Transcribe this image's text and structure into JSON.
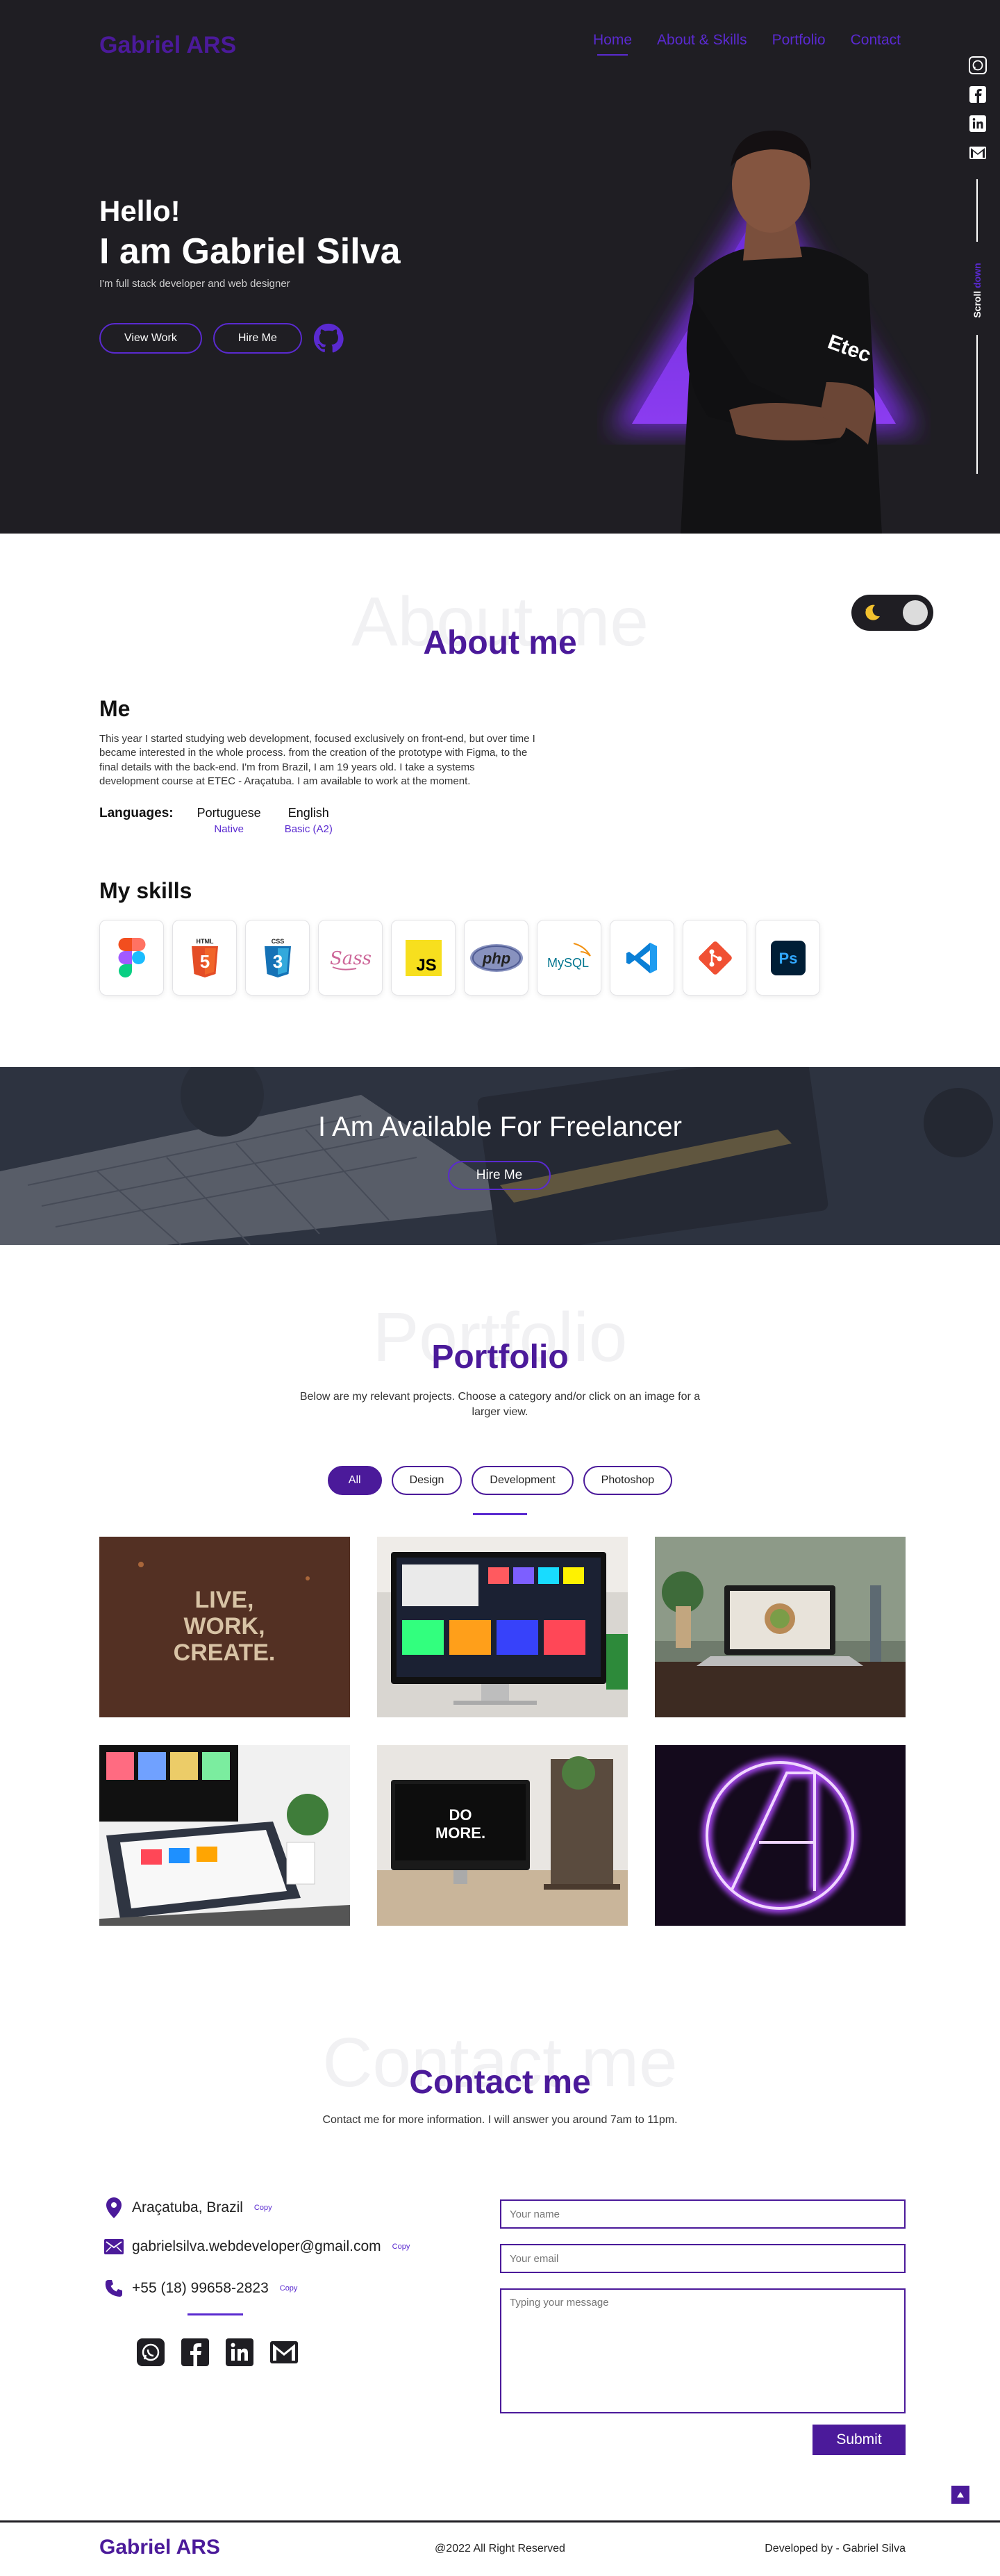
{
  "brand": {
    "logo": "Gabriel ARS"
  },
  "nav": {
    "home": "Home",
    "about": "About & Skills",
    "portfolio": "Portfolio",
    "contact": "Contact"
  },
  "hero": {
    "hello": "Hello!",
    "name": "I am Gabriel Silva",
    "subtitle": "I'm full stack developer and web designer",
    "view_work": "View Work",
    "hire_me": "Hire Me",
    "scroll_word": "Scroll",
    "scroll_dim": "down",
    "shirt_text": "Etec"
  },
  "about": {
    "bg_title": "About me",
    "title": "About me",
    "me_title": "Me",
    "me_text": "This year I started studying web development, focused exclusively on front-end, but over time I became interested in the whole process. from the creation of the prototype with Figma, to the final details with the back-end. I'm from Brazil, I am 19 years old. I take a systems development course at ETEC - Araçatuba. I am available to work at the moment.",
    "languages_label": "Languages:",
    "languages": [
      {
        "name": "Portuguese",
        "level": "Native"
      },
      {
        "name": "English",
        "level": "Basic (A2)"
      }
    ],
    "skills_title": "My skills",
    "skills": [
      "figma-icon",
      "html5-icon",
      "css3-icon",
      "sass-icon",
      "javascript-icon",
      "php-icon",
      "mysql-icon",
      "vscode-icon",
      "git-icon",
      "photoshop-icon"
    ],
    "skill_labels": {
      "html": "HTML",
      "css": "CSS",
      "sass": "Sass",
      "js": "JS",
      "php": "php",
      "mysql": "MySQL",
      "ps": "Ps"
    }
  },
  "freelance": {
    "title": "I Am Available For Freelancer",
    "hire": "Hire Me"
  },
  "portfolio": {
    "bg_title": "Portfolio",
    "title": "Portfolio",
    "description": "Below are my relevant projects. Choose a category and/or click on an image for a larger view.",
    "filters": [
      "All",
      "Design",
      "Development",
      "Photoshop"
    ],
    "item1_text": [
      "LIVE,",
      "WORK,",
      "CREATE."
    ],
    "item5_text": [
      "DO",
      "MORE."
    ]
  },
  "contact": {
    "bg_title": "Contact me",
    "title": "Contact me",
    "description": "Contact me for more information. I will answer you around 7am to 11pm.",
    "location": "Araçatuba, Brazil",
    "email": "gabrielsilva.webdeveloper@gmail.com",
    "phone": "+55 (18) 99658-2823",
    "copy": "Copy",
    "name_placeholder": "Your name",
    "email_placeholder": "Your email",
    "message_placeholder": "Typing your message",
    "submit": "Submit"
  },
  "footer": {
    "logo": "Gabriel ARS",
    "copyright": "@2022 All Right Reserved",
    "developed": "Developed by - Gabriel Silva"
  },
  "colors": {
    "accent": "#4b1a9a",
    "accent_light": "#5a2ad0",
    "hero_bg": "#1f1e23"
  }
}
